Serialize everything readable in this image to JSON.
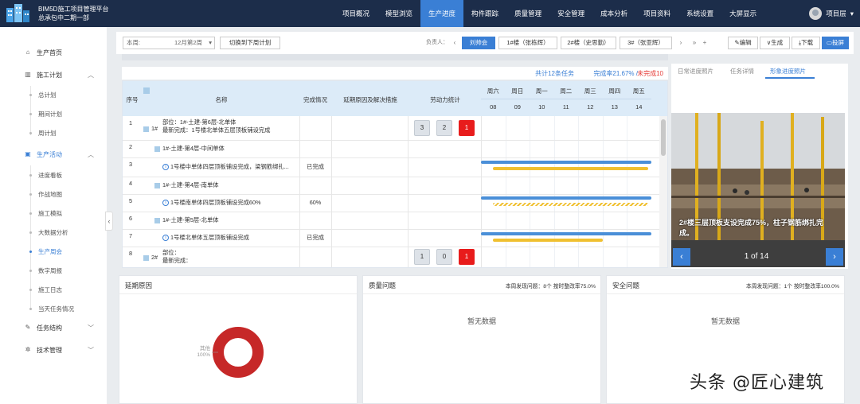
{
  "app": {
    "title_line1": "BIM5D施工项目管理平台",
    "title_line2": "总承包中二期一部"
  },
  "nav": [
    "项目概况",
    "模型浏览",
    "生产进度",
    "构件跟踪",
    "质量管理",
    "安全管理",
    "成本分析",
    "项目资料",
    "系统设置",
    "大屏显示"
  ],
  "nav_active_index": 2,
  "user": {
    "name": "项目层"
  },
  "sidebar": {
    "items": [
      {
        "label": "生产首页",
        "icon": "home-icon"
      },
      {
        "label": "施工计划",
        "icon": "bar-chart-icon",
        "children": [
          "总计划",
          "期间计划",
          "周计划"
        ]
      },
      {
        "label": "生产活动",
        "icon": "monitor-icon",
        "children": [
          "进度看板",
          "作战地图",
          "施工模拟",
          "大数据分析",
          "生产周会",
          "数字周报",
          "施工日志",
          "当天任务情况"
        ]
      },
      {
        "label": "任务结构",
        "icon": "pencil-icon"
      },
      {
        "label": "技术管理",
        "icon": "gear-icon"
      }
    ],
    "active_child": "生产周会"
  },
  "toolbar": {
    "select_label": "本周:",
    "select_value": "12月第2周",
    "switch_button": "切换到下周计划",
    "owner_label": "负责人：",
    "owner_tabs": [
      "刘帅会",
      "1#楼（张栋辉）",
      "2#楼（史思勤）",
      "3#（张亚辉）"
    ],
    "more": "»",
    "add": "+",
    "actions": [
      "编辑",
      "生成",
      "下载",
      "投屏"
    ]
  },
  "summary": {
    "tasks": "共计12条任务",
    "rate": "完成率21.67%",
    "sep": "/",
    "unfinished": "未完成10"
  },
  "table": {
    "headers": {
      "no": "序号",
      "name": "名称",
      "status": "完成情况",
      "delay": "延期原因及解决措施",
      "labor": "劳动力统计"
    },
    "days": [
      {
        "w": "周六",
        "d": "08"
      },
      {
        "w": "周日",
        "d": "09"
      },
      {
        "w": "周一",
        "d": "10"
      },
      {
        "w": "周二",
        "d": "11"
      },
      {
        "w": "周三",
        "d": "12"
      },
      {
        "w": "周四",
        "d": "13"
      },
      {
        "w": "周五",
        "d": "14"
      }
    ],
    "rows": [
      {
        "no": "1",
        "group": "1#",
        "line1": "部位：1#-土建-第6层-北单体",
        "line2": "最新完成：1号楼北单体五层顶板铺设完成",
        "status": "",
        "labor": [
          "3",
          "2",
          "1"
        ]
      },
      {
        "no": "2",
        "name": "1#-土建-第4层-中间单体",
        "status": ""
      },
      {
        "no": "3",
        "name": "1号楼中单体四层顶板铺设完成，梁钢筋绑扎...",
        "status": "已完成",
        "info": true
      },
      {
        "no": "4",
        "name": "1#-土建-第4层-南单体",
        "status": ""
      },
      {
        "no": "5",
        "name": "1号楼南单体四层顶板铺设完成60%",
        "status": "60%",
        "info": true
      },
      {
        "no": "6",
        "name": "1#-土建-第5层-北单体",
        "status": ""
      },
      {
        "no": "7",
        "name": "1号楼北单体五层顶板铺设完成",
        "status": "已完成",
        "info": true
      },
      {
        "no": "8",
        "group": "2#",
        "line1": "部位：",
        "line2": "最新完成：",
        "status": "",
        "labor": [
          "1",
          "0",
          "1"
        ]
      }
    ]
  },
  "right_panel": {
    "tabs": [
      "日常进度照片",
      "任务详情",
      "形象进度照片"
    ],
    "active_tab": 2,
    "caption": "2#楼三层顶板支设完成75%，柱子钢筋绑扎完成。",
    "counter": "1 of 14",
    "prev": "‹",
    "next": "›"
  },
  "cards": {
    "delay": {
      "title": "延期原因",
      "legend_label": "其他",
      "legend_value": "100%",
      "share_other": 100
    },
    "quality": {
      "title": "质量问题",
      "stat": "本周发现问题：8个  按时整改率75.0%",
      "empty": "暂无数据"
    },
    "safety": {
      "title": "安全问题",
      "stat": "本周发现问题：1个  按时整改率100.0%",
      "empty": "暂无数据"
    }
  },
  "watermark": "头条 @匠心建筑",
  "colors": {
    "topbar": "#1c2d4a",
    "accent": "#3a7fd5",
    "danger": "#e81c1c",
    "gantt_plan": "#4a8fd8",
    "gantt_actual": "#f0c030",
    "donut": "#c62828"
  }
}
